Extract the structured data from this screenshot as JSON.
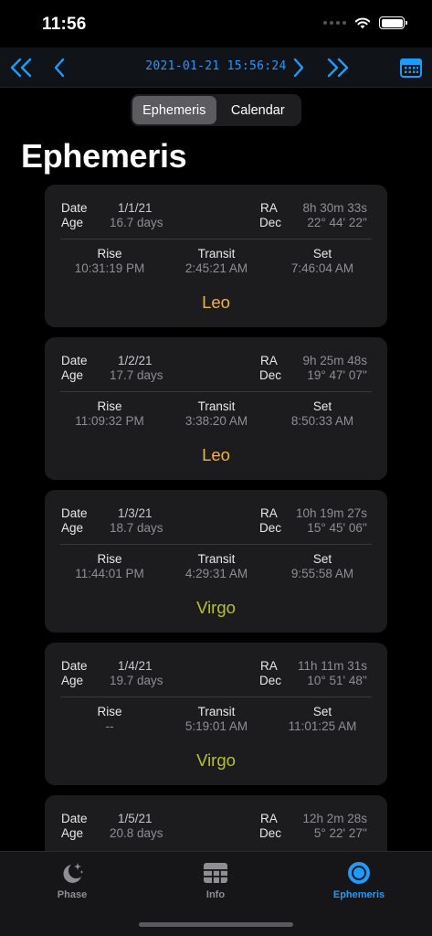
{
  "status": {
    "time": "11:56"
  },
  "nav": {
    "datetime": "2021-01-21 15:56:24"
  },
  "segments": [
    {
      "label": "Ephemeris",
      "active": true
    },
    {
      "label": "Calendar",
      "active": false
    }
  ],
  "title": "Ephemeris",
  "labels": {
    "date": "Date",
    "age": "Age",
    "ra": "RA",
    "dec": "Dec",
    "rise": "Rise",
    "transit": "Transit",
    "set": "Set"
  },
  "entries": [
    {
      "date": "1/1/21",
      "age": "16.7 days",
      "ra": "8h 30m 33s",
      "dec": "22° 44' 22''",
      "rise": "10:31:19 PM",
      "transit": "2:45:21 AM",
      "set": "7:46:04 AM",
      "sign": "Leo",
      "sign_color": "#f5b52b"
    },
    {
      "date": "1/2/21",
      "age": "17.7 days",
      "ra": "9h 25m 48s",
      "dec": "19° 47' 07''",
      "rise": "11:09:32 PM",
      "transit": "3:38:20 AM",
      "set": "8:50:33 AM",
      "sign": "Leo",
      "sign_color": "#f5b52b"
    },
    {
      "date": "1/3/21",
      "age": "18.7 days",
      "ra": "10h 19m 27s",
      "dec": "15° 45' 06''",
      "rise": "11:44:01 PM",
      "transit": "4:29:31 AM",
      "set": "9:55:58 AM",
      "sign": "Virgo",
      "sign_color": "#b5c22b"
    },
    {
      "date": "1/4/21",
      "age": "19.7 days",
      "ra": "11h 11m 31s",
      "dec": "10° 51' 48''",
      "rise": "--",
      "transit": "5:19:01 AM",
      "set": "11:01:25 AM",
      "sign": "Virgo",
      "sign_color": "#b5c22b"
    },
    {
      "date": "1/5/21",
      "age": "20.8 days",
      "ra": "12h 2m 28s",
      "dec": "5° 22' 27''",
      "rise": "",
      "transit": "",
      "set": "",
      "sign": "",
      "sign_color": "#b5c22b"
    }
  ],
  "tabs": [
    {
      "label": "Phase",
      "icon": "moon-stars-icon",
      "active": false
    },
    {
      "label": "Info",
      "icon": "table-icon",
      "active": false
    },
    {
      "label": "Ephemeris",
      "icon": "target-icon",
      "active": true
    }
  ],
  "colors": {
    "accent": "#1e9bff",
    "inactive_tab": "#8e8e93"
  }
}
